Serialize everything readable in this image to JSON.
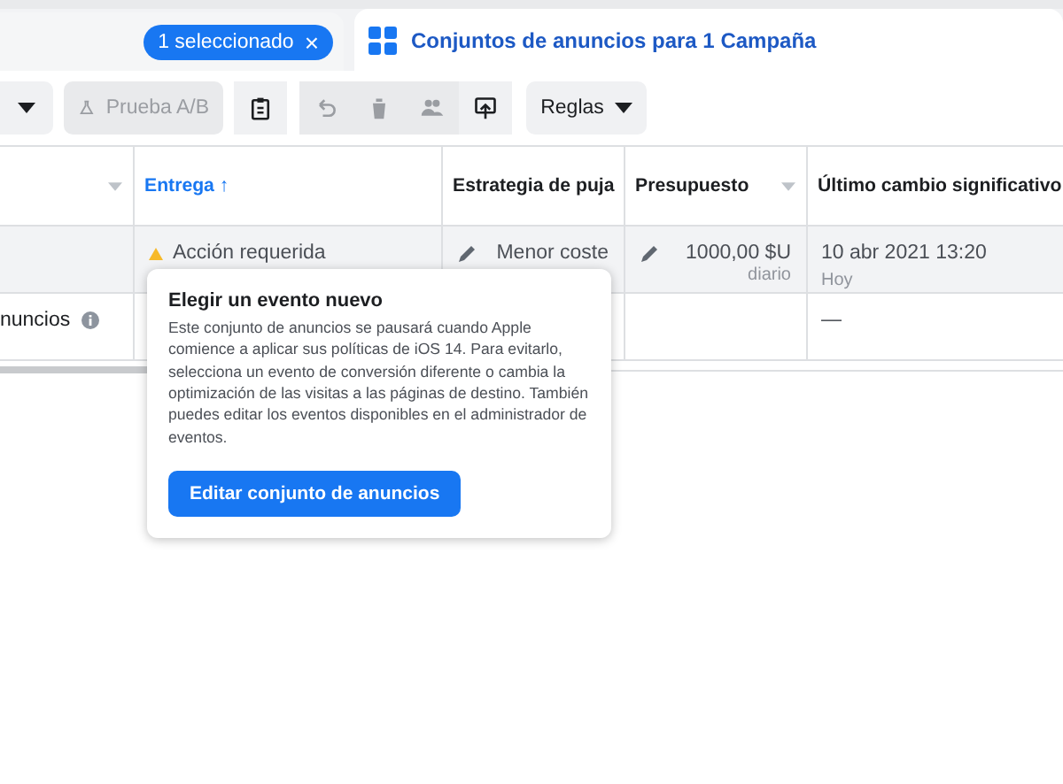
{
  "selection_chip": {
    "label": "1 seleccionado",
    "close": "×"
  },
  "tab": {
    "label": "Conjuntos de anuncios para 1 Campaña",
    "selected": true
  },
  "toolbar": [
    {
      "kind": "caret",
      "disabled": false
    },
    {
      "kind": "text",
      "label": "Prueba A/B",
      "disabled": true
    },
    {
      "kind": "icon",
      "disabled": false
    },
    {
      "kind": "icon",
      "disabled": true
    },
    {
      "kind": "icon",
      "disabled": true
    },
    {
      "kind": "icon",
      "disabled": true
    },
    {
      "kind": "icon",
      "disabled": false
    },
    {
      "kind": "menu",
      "label": "Reglas",
      "disabled": false
    }
  ],
  "table": {
    "columns": [
      {
        "menu": true
      },
      {
        "label": "Entrega ↑",
        "sorted": true,
        "menu": false
      },
      {
        "label": "Estrategia de puja",
        "sorted": false,
        "menu": false
      },
      {
        "label": "Presupuesto",
        "sorted": false,
        "menu": true
      },
      {
        "label": "Último cambio significativo",
        "sorted": false,
        "menu": false
      }
    ],
    "rows": [
      {
        "selected": true,
        "delivery": "Acción requerida",
        "warning": true,
        "bid": "Menor coste",
        "budget": "1000,00 $U",
        "budget_sub": "diario",
        "changed": "10 abr 2021 13:20",
        "changed_sub": "Hoy"
      },
      {
        "selected": false,
        "name": "nuncios",
        "info": true,
        "changed": "—"
      }
    ]
  },
  "popover": {
    "title": "Elegir un evento nuevo",
    "body": "Este conjunto de anuncios se pausará cuando Apple comience a aplicar sus políticas de iOS 14. Para evitarlo, selecciona un evento de conversión diferente o cambia la optimización de las visitas a las páginas de destino. También puedes editar los eventos disponibles en el administrador de eventos.",
    "button": "Editar conjunto de anuncios"
  }
}
